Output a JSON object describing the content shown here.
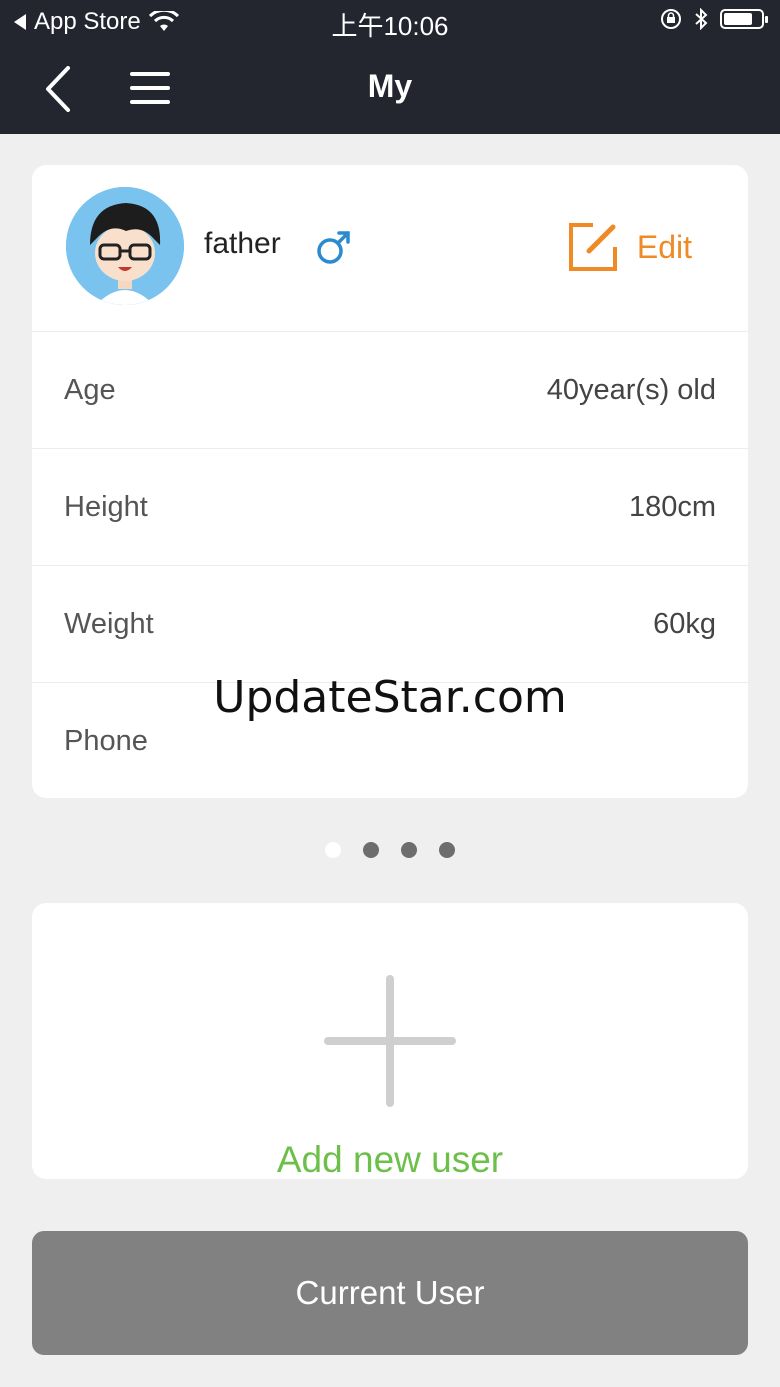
{
  "status_bar": {
    "back_app": "App Store",
    "time": "上午10:06"
  },
  "nav": {
    "title": "My"
  },
  "profile": {
    "name": "father",
    "edit_label": "Edit",
    "rows": [
      {
        "label": "Age",
        "value": "40year(s) old"
      },
      {
        "label": "Height",
        "value": "180cm"
      },
      {
        "label": "Weight",
        "value": "60kg"
      },
      {
        "label": "Phone",
        "value": ""
      }
    ]
  },
  "watermark": "UpdateStar.com",
  "pager": {
    "count": 4,
    "active_index": 0
  },
  "add_user": {
    "label": "Add new user"
  },
  "current_user_button": "Current User",
  "colors": {
    "header_bg": "#23252f",
    "accent_orange": "#ef8a25",
    "accent_green": "#6cc04a",
    "male_blue": "#2a8bd0",
    "button_gray": "#818181"
  }
}
